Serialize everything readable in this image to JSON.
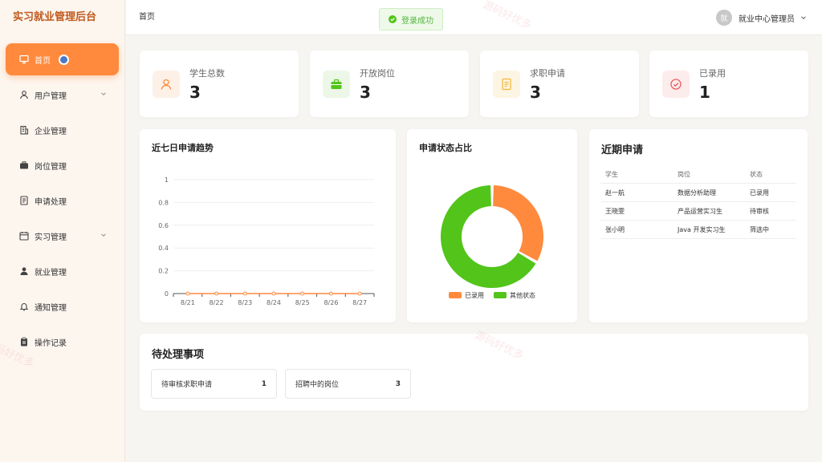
{
  "app": {
    "title": "实习就业管理后台"
  },
  "sidebar": {
    "items": [
      {
        "label": "首页",
        "icon": "monitor-icon"
      },
      {
        "label": "用户管理",
        "icon": "user-icon"
      },
      {
        "label": "企业管理",
        "icon": "building-icon"
      },
      {
        "label": "岗位管理",
        "icon": "briefcase-icon"
      },
      {
        "label": "申请处理",
        "icon": "document-icon"
      },
      {
        "label": "实习管理",
        "icon": "calendar-icon"
      },
      {
        "label": "就业管理",
        "icon": "person-icon"
      },
      {
        "label": "通知管理",
        "icon": "bell-icon"
      },
      {
        "label": "操作记录",
        "icon": "clipboard-icon"
      }
    ]
  },
  "header": {
    "breadcrumb": "首页",
    "toast": "登录成功",
    "user_avatar": "就",
    "user_name": "就业中心管理员"
  },
  "stats": [
    {
      "label": "学生总数",
      "value": "3",
      "icon": "user-icon",
      "color": "#ff8a3d"
    },
    {
      "label": "开放岗位",
      "value": "3",
      "icon": "briefcase-icon",
      "color": "#52c41a"
    },
    {
      "label": "求职申请",
      "value": "3",
      "icon": "document-icon",
      "color": "#f5b83d"
    },
    {
      "label": "已录用",
      "value": "1",
      "icon": "check-circle-icon",
      "color": "#f05a5a"
    }
  ],
  "trend": {
    "title": "近七日申请趋势"
  },
  "status_chart": {
    "title": "申请状态占比"
  },
  "chart_data": [
    {
      "type": "line",
      "title": "近七日申请趋势",
      "categories": [
        "8/21",
        "8/22",
        "8/23",
        "8/24",
        "8/25",
        "8/26",
        "8/27"
      ],
      "values": [
        0,
        0,
        0,
        0,
        0,
        0,
        0
      ],
      "yticks": [
        "0",
        "0.2",
        "0.4",
        "0.6",
        "0.8",
        "1"
      ],
      "ylim": [
        0,
        1
      ],
      "grid": true,
      "color": "#ff8a3d"
    },
    {
      "type": "pie",
      "title": "申请状态占比",
      "labels": [
        "已录用",
        "其他状态"
      ],
      "values": [
        1,
        2
      ],
      "colors": [
        "#ff8a3d",
        "#52c41a"
      ],
      "legend": "bottom"
    }
  ],
  "recent": {
    "title": "近期申请",
    "headers": [
      "学生",
      "岗位",
      "状态"
    ],
    "rows": [
      [
        "赵一航",
        "数据分析助理",
        "已录用"
      ],
      [
        "王晓雯",
        "产品运营实习生",
        "待审核"
      ],
      [
        "张小明",
        "Java 开发实习生",
        "筛选中"
      ]
    ]
  },
  "todo": {
    "title": "待处理事项",
    "items": [
      {
        "label": "待审核求职申请",
        "count": "1"
      },
      {
        "label": "招聘中的岗位",
        "count": "3"
      }
    ]
  },
  "watermark": "源码好优多"
}
